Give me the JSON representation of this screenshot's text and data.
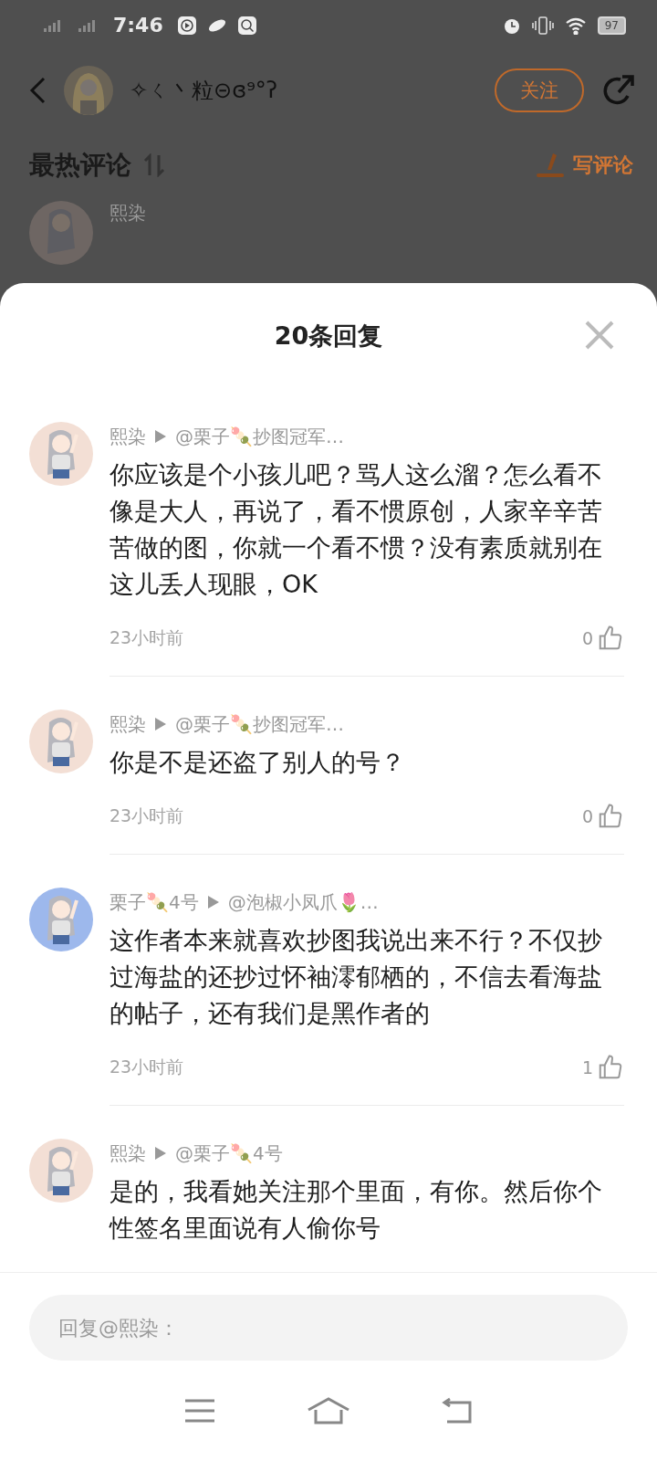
{
  "status_bar": {
    "time": "7:46",
    "battery": "97"
  },
  "header": {
    "author": "✧ㄑ丶粒⊝ɞ⁹°ʔ",
    "follow_button": "关注"
  },
  "section": {
    "title": "最热评论",
    "write_button": "写评论",
    "first_author": "熙染"
  },
  "sheet": {
    "title": "20条回复",
    "replies": [
      {
        "author": "熙染",
        "target": "@栗子🍡抄图冠军…",
        "text": "你应该是个小孩儿吧？骂人这么溜？怎么看不像是大人，再说了，看不惯原创，人家辛辛苦苦做的图，你就一个看不惯？没有素质就别在这儿丢人现眼，OK",
        "time": "23小时前",
        "likes": "0",
        "color": "#f3dfd5"
      },
      {
        "author": "熙染",
        "target": "@栗子🍡抄图冠军…",
        "text": "你是不是还盗了别人的号？",
        "time": "23小时前",
        "likes": "0",
        "color": "#f3dfd5"
      },
      {
        "author": "栗子🍡4号",
        "target": "@泡椒小凤爪🌷…",
        "text": "这作者本来就喜欢抄图我说出来不行？不仅抄过海盐的还抄过怀袖澪郁栖的，不信去看海盐的帖子，还有我们是黑作者的",
        "time": "23小时前",
        "likes": "1",
        "color": "#9db8ec"
      },
      {
        "author": "熙染",
        "target": "@栗子🍡4号",
        "text": "是的，我看她关注那个里面，有你。然后你个性签名里面说有人偷你号",
        "color": "#f3dfd5"
      }
    ]
  },
  "reply_field": {
    "placeholder": "回复@熙染："
  }
}
